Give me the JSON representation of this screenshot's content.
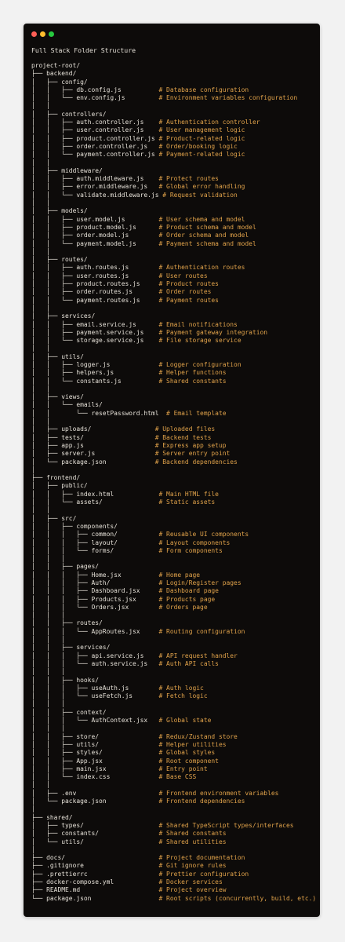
{
  "window": {
    "title": "Full Stack Folder Structure",
    "controls": [
      "close",
      "minimize",
      "maximize"
    ]
  },
  "colors": {
    "background": "#0d0b0a",
    "text": "#e6e1d8",
    "comment": "#e0a24a"
  },
  "tree": [
    {
      "t": "project-root/",
      "c": ""
    },
    {
      "t": "├── backend/",
      "c": ""
    },
    {
      "t": "│   ├── config/",
      "c": ""
    },
    {
      "t": "│   │   ├── db.config.js          ",
      "c": "# Database configuration"
    },
    {
      "t": "│   │   └── env.config.js         ",
      "c": "# Environment variables configuration"
    },
    {
      "t": "│   │",
      "c": ""
    },
    {
      "t": "│   ├── controllers/",
      "c": ""
    },
    {
      "t": "│   │   ├── auth.controller.js    ",
      "c": "# Authentication controller"
    },
    {
      "t": "│   │   ├── user.controller.js    ",
      "c": "# User management logic"
    },
    {
      "t": "│   │   ├── product.controller.js ",
      "c": "# Product-related logic"
    },
    {
      "t": "│   │   ├── order.controller.js   ",
      "c": "# Order/booking logic"
    },
    {
      "t": "│   │   └── payment.controller.js ",
      "c": "# Payment-related logic"
    },
    {
      "t": "│   │",
      "c": ""
    },
    {
      "t": "│   ├── middleware/",
      "c": ""
    },
    {
      "t": "│   │   ├── auth.middleware.js    ",
      "c": "# Protect routes"
    },
    {
      "t": "│   │   ├── error.middleware.js   ",
      "c": "# Global error handling"
    },
    {
      "t": "│   │   └── validate.middleware.js ",
      "c": "# Request validation"
    },
    {
      "t": "│   │",
      "c": ""
    },
    {
      "t": "│   ├── models/",
      "c": ""
    },
    {
      "t": "│   │   ├── user.model.js         ",
      "c": "# User schema and model"
    },
    {
      "t": "│   │   ├── product.model.js      ",
      "c": "# Product schema and model"
    },
    {
      "t": "│   │   ├── order.model.js        ",
      "c": "# Order schema and model"
    },
    {
      "t": "│   │   └── payment.model.js      ",
      "c": "# Payment schema and model"
    },
    {
      "t": "│   │",
      "c": ""
    },
    {
      "t": "│   ├── routes/",
      "c": ""
    },
    {
      "t": "│   │   ├── auth.routes.js        ",
      "c": "# Authentication routes"
    },
    {
      "t": "│   │   ├── user.routes.js        ",
      "c": "# User routes"
    },
    {
      "t": "│   │   ├── product.routes.js     ",
      "c": "# Product routes"
    },
    {
      "t": "│   │   ├── order.routes.js       ",
      "c": "# Order routes"
    },
    {
      "t": "│   │   └── payment.routes.js     ",
      "c": "# Payment routes"
    },
    {
      "t": "│   │",
      "c": ""
    },
    {
      "t": "│   ├── services/",
      "c": ""
    },
    {
      "t": "│   │   ├── email.service.js      ",
      "c": "# Email notifications"
    },
    {
      "t": "│   │   ├── payment.service.js    ",
      "c": "# Payment gateway integration"
    },
    {
      "t": "│   │   └── storage.service.js    ",
      "c": "# File storage service"
    },
    {
      "t": "│   │",
      "c": ""
    },
    {
      "t": "│   ├── utils/",
      "c": ""
    },
    {
      "t": "│   │   ├── logger.js             ",
      "c": "# Logger configuration"
    },
    {
      "t": "│   │   ├── helpers.js            ",
      "c": "# Helper functions"
    },
    {
      "t": "│   │   └── constants.js          ",
      "c": "# Shared constants"
    },
    {
      "t": "│   │",
      "c": ""
    },
    {
      "t": "│   ├── views/",
      "c": ""
    },
    {
      "t": "│   │   └── emails/",
      "c": ""
    },
    {
      "t": "│   │       └── resetPassword.html  ",
      "c": "# Email template"
    },
    {
      "t": "│   │",
      "c": ""
    },
    {
      "t": "│   ├── uploads/                 ",
      "c": "# Uploaded files"
    },
    {
      "t": "│   ├── tests/                   ",
      "c": "# Backend tests"
    },
    {
      "t": "│   ├── app.js                   ",
      "c": "# Express app setup"
    },
    {
      "t": "│   ├── server.js                ",
      "c": "# Server entry point"
    },
    {
      "t": "│   └── package.json             ",
      "c": "# Backend dependencies"
    },
    {
      "t": "│",
      "c": ""
    },
    {
      "t": "├── frontend/",
      "c": ""
    },
    {
      "t": "│   ├── public/",
      "c": ""
    },
    {
      "t": "│   │   ├── index.html            ",
      "c": "# Main HTML file"
    },
    {
      "t": "│   │   └── assets/               ",
      "c": "# Static assets"
    },
    {
      "t": "│   │",
      "c": ""
    },
    {
      "t": "│   ├── src/",
      "c": ""
    },
    {
      "t": "│   │   ├── components/",
      "c": ""
    },
    {
      "t": "│   │   │   ├── common/           ",
      "c": "# Reusable UI components"
    },
    {
      "t": "│   │   │   ├── layout/           ",
      "c": "# Layout components"
    },
    {
      "t": "│   │   │   └── forms/            ",
      "c": "# Form components"
    },
    {
      "t": "│   │   │",
      "c": ""
    },
    {
      "t": "│   │   ├── pages/",
      "c": ""
    },
    {
      "t": "│   │   │   ├── Home.jsx          ",
      "c": "# Home page"
    },
    {
      "t": "│   │   │   ├── Auth/             ",
      "c": "# Login/Register pages"
    },
    {
      "t": "│   │   │   ├── Dashboard.jsx     ",
      "c": "# Dashboard page"
    },
    {
      "t": "│   │   │   ├── Products.jsx      ",
      "c": "# Products page"
    },
    {
      "t": "│   │   │   └── Orders.jsx        ",
      "c": "# Orders page"
    },
    {
      "t": "│   │   │",
      "c": ""
    },
    {
      "t": "│   │   ├── routes/",
      "c": ""
    },
    {
      "t": "│   │   │   └── AppRoutes.jsx     ",
      "c": "# Routing configuration"
    },
    {
      "t": "│   │   │",
      "c": ""
    },
    {
      "t": "│   │   ├── services/",
      "c": ""
    },
    {
      "t": "│   │   │   ├── api.service.js    ",
      "c": "# API request handler"
    },
    {
      "t": "│   │   │   └── auth.service.js   ",
      "c": "# Auth API calls"
    },
    {
      "t": "│   │   │",
      "c": ""
    },
    {
      "t": "│   │   ├── hooks/",
      "c": ""
    },
    {
      "t": "│   │   │   ├── useAuth.js        ",
      "c": "# Auth logic"
    },
    {
      "t": "│   │   │   └── useFetch.js       ",
      "c": "# Fetch logic"
    },
    {
      "t": "│   │   │",
      "c": ""
    },
    {
      "t": "│   │   ├── context/",
      "c": ""
    },
    {
      "t": "│   │   │   └── AuthContext.jsx   ",
      "c": "# Global state"
    },
    {
      "t": "│   │   │",
      "c": ""
    },
    {
      "t": "│   │   ├── store/                ",
      "c": "# Redux/Zustand store"
    },
    {
      "t": "│   │   ├── utils/                ",
      "c": "# Helper utilities"
    },
    {
      "t": "│   │   ├── styles/               ",
      "c": "# Global styles"
    },
    {
      "t": "│   │   ├── App.jsx               ",
      "c": "# Root component"
    },
    {
      "t": "│   │   ├── main.jsx              ",
      "c": "# Entry point"
    },
    {
      "t": "│   │   └── index.css             ",
      "c": "# Base CSS"
    },
    {
      "t": "│   │",
      "c": ""
    },
    {
      "t": "│   ├── .env                      ",
      "c": "# Frontend environment variables"
    },
    {
      "t": "│   └── package.json              ",
      "c": "# Frontend dependencies"
    },
    {
      "t": "│",
      "c": ""
    },
    {
      "t": "├── shared/",
      "c": ""
    },
    {
      "t": "│   ├── types/                    ",
      "c": "# Shared TypeScript types/interfaces"
    },
    {
      "t": "│   ├── constants/                ",
      "c": "# Shared constants"
    },
    {
      "t": "│   └── utils/                    ",
      "c": "# Shared utilities"
    },
    {
      "t": "│",
      "c": ""
    },
    {
      "t": "├── docs/                         ",
      "c": "# Project documentation"
    },
    {
      "t": "├── .gitignore                    ",
      "c": "# Git ignore rules"
    },
    {
      "t": "├── .prettierrc                   ",
      "c": "# Prettier configuration"
    },
    {
      "t": "├── docker-compose.yml            ",
      "c": "# Docker services"
    },
    {
      "t": "├── README.md                     ",
      "c": "# Project overview"
    },
    {
      "t": "└── package.json                  ",
      "c": "# Root scripts (concurrently, build, etc.)"
    }
  ]
}
